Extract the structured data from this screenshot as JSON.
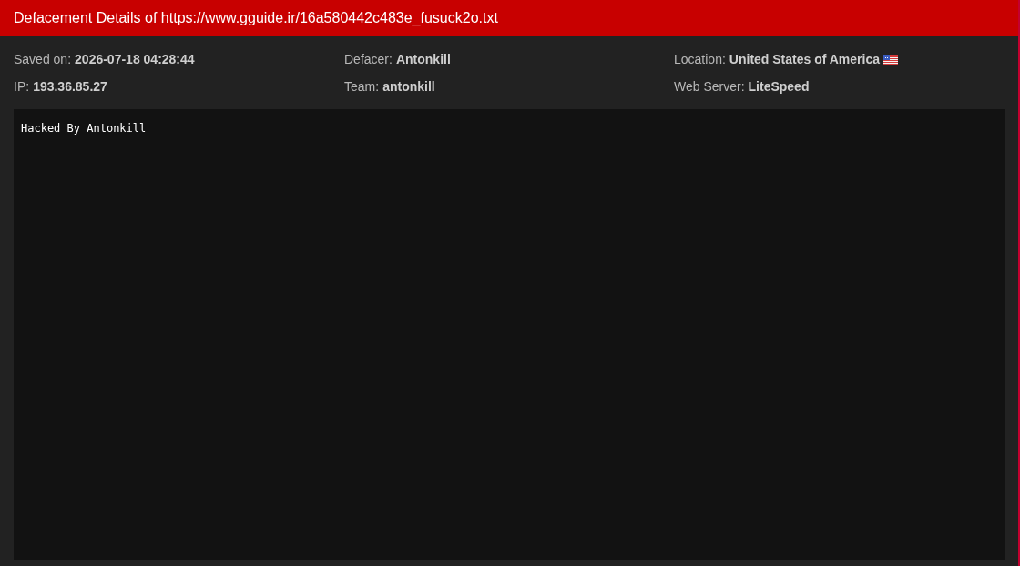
{
  "header": {
    "title": "Defacement Details of https://www.gguide.ir/16a580442c483e_fusuck2o.txt"
  },
  "details": [
    {
      "kind": "plain",
      "label": "Saved on:",
      "value": "2026-07-18 04:28:44"
    },
    {
      "kind": "plain",
      "label": "Defacer:",
      "value": "Antonkill"
    },
    {
      "kind": "flag",
      "label": "Location:",
      "value": "United States of America"
    },
    {
      "kind": "plain",
      "label": "IP:",
      "value": "193.36.85.27"
    },
    {
      "kind": "plain",
      "label": "Team:",
      "value": "antonkill"
    },
    {
      "kind": "plain",
      "label": "Web Server:",
      "value": "LiteSpeed"
    }
  ],
  "content": {
    "lines": [
      "Hacked By Antonkill"
    ]
  }
}
